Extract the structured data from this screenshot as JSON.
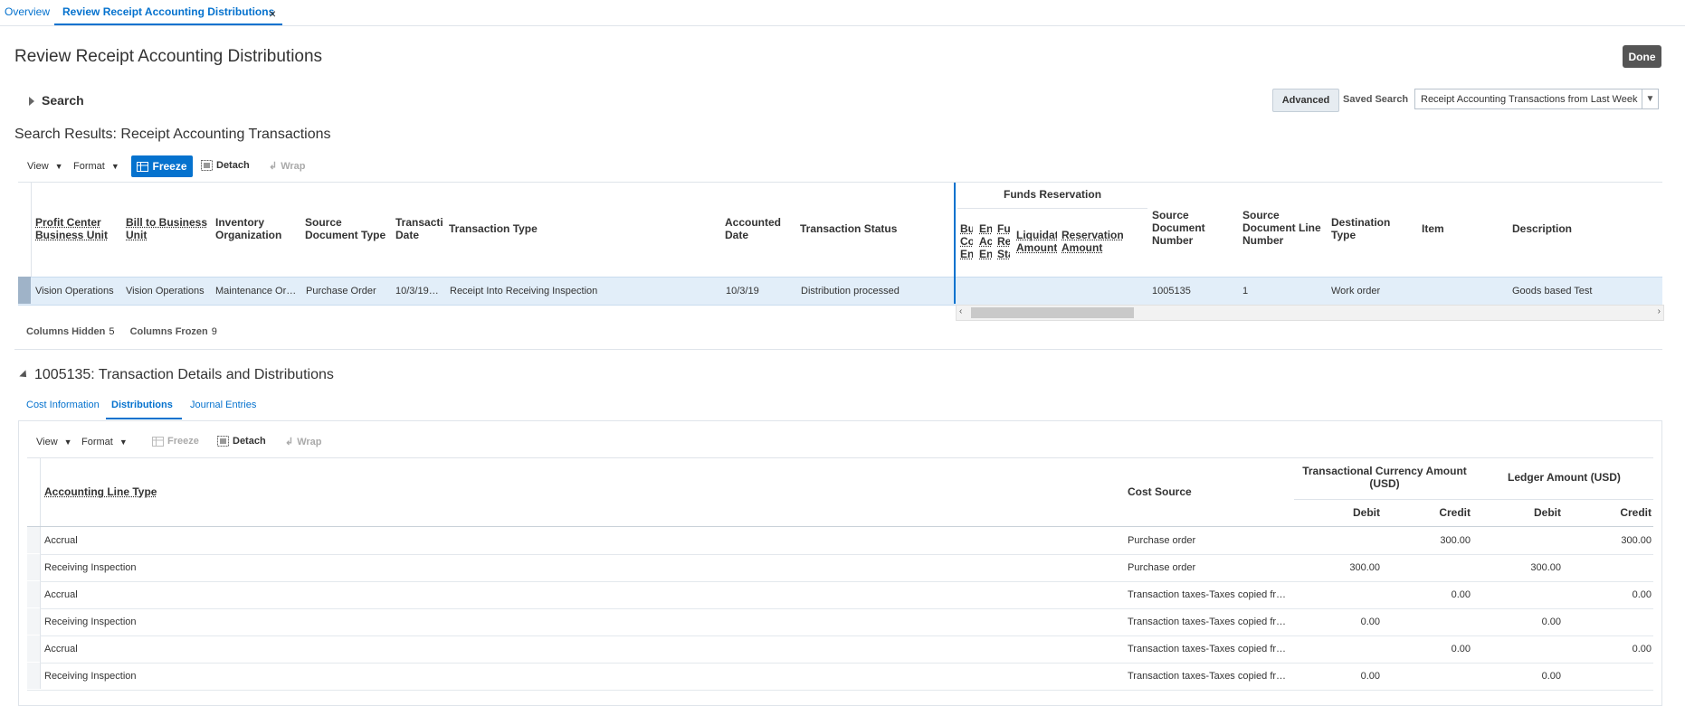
{
  "tabs": [
    {
      "label": "Overview"
    },
    {
      "label": "Review Receipt Accounting Distributions",
      "close": "×"
    }
  ],
  "page": {
    "title": "Review Receipt Accounting Distributions",
    "done_label": "Done"
  },
  "search": {
    "label": "Search",
    "advanced_label": "Advanced",
    "saved_search_label": "Saved Search",
    "saved_search_value": "Receipt Accounting Transactions from Last Week"
  },
  "results": {
    "title": "Search Results: Receipt Accounting Transactions",
    "toolbar": {
      "view": "View",
      "format": "Format",
      "freeze": "Freeze",
      "detach": "Detach",
      "wrap": "Wrap"
    },
    "group_header": "Funds Reservation",
    "columns": {
      "profit_center": "Profit Center Business Unit",
      "bill_to": "Bill to Business Unit",
      "inventory_org": "Inventory Organization",
      "source_doc_type": "Source Document Type",
      "transaction_date": "Transacti Date",
      "transaction_type": "Transaction Type",
      "accounted_date": "Accounted Date",
      "transaction_status": "Transaction Status",
      "fr1": "Bu Co En",
      "fr2": "En Ac En",
      "fr3": "Fu Re Sta",
      "liquidation_amount": "Liquidat Amount",
      "reservation_amount": "Reservation Amount",
      "source_doc_number": "Source Document Number",
      "source_doc_line": "Source Document Line Number",
      "destination_type": "Destination Type",
      "item": "Item",
      "description": "Description"
    },
    "row": {
      "profit_center": "Vision Operations",
      "bill_to": "Vision Operations",
      "inventory_org": "Maintenance Or…",
      "source_doc_type": "Purchase Order",
      "transaction_date": "10/3/19…",
      "transaction_type": "Receipt Into Receiving Inspection",
      "accounted_date": "10/3/19",
      "transaction_status": "Distribution processed",
      "source_doc_number": "1005135",
      "source_doc_line": "1",
      "destination_type": "Work order",
      "item": "",
      "description": "Goods based Test"
    },
    "status": {
      "hidden_label": "Columns Hidden",
      "hidden_value": "5",
      "frozen_label": "Columns Frozen",
      "frozen_value": "9"
    }
  },
  "details": {
    "title": "1005135: Transaction Details and Distributions",
    "subtabs": [
      "Cost Information",
      "Distributions",
      "Journal Entries"
    ],
    "toolbar": {
      "view": "View",
      "format": "Format",
      "freeze": "Freeze",
      "detach": "Detach",
      "wrap": "Wrap"
    },
    "columns": {
      "line_type": "Accounting Line Type",
      "cost_source": "Cost Source",
      "trx_group": "Transactional Currency Amount (USD)",
      "ledger_group": "Ledger Amount (USD)",
      "debit": "Debit",
      "credit": "Credit"
    },
    "rows": [
      {
        "line_type": "Accrual",
        "cost_source": "Purchase order",
        "trx_debit": "",
        "trx_credit": "300.00",
        "led_debit": "",
        "led_credit": "300.00"
      },
      {
        "line_type": "Receiving Inspection",
        "cost_source": "Purchase order",
        "trx_debit": "300.00",
        "trx_credit": "",
        "led_debit": "300.00",
        "led_credit": ""
      },
      {
        "line_type": "Accrual",
        "cost_source": "Transaction taxes-Taxes copied fr…",
        "trx_debit": "",
        "trx_credit": "0.00",
        "led_debit": "",
        "led_credit": "0.00"
      },
      {
        "line_type": "Receiving Inspection",
        "cost_source": "Transaction taxes-Taxes copied fr…",
        "trx_debit": "0.00",
        "trx_credit": "",
        "led_debit": "0.00",
        "led_credit": ""
      },
      {
        "line_type": "Accrual",
        "cost_source": "Transaction taxes-Taxes copied fr…",
        "trx_debit": "",
        "trx_credit": "0.00",
        "led_debit": "",
        "led_credit": "0.00"
      },
      {
        "line_type": "Receiving Inspection",
        "cost_source": "Transaction taxes-Taxes copied fr…",
        "trx_debit": "0.00",
        "trx_credit": "",
        "led_debit": "0.00",
        "led_credit": ""
      }
    ]
  },
  "colors": {
    "accent": "#0572ce",
    "selected_row": "#e2eef9",
    "done_button": "#555555"
  }
}
